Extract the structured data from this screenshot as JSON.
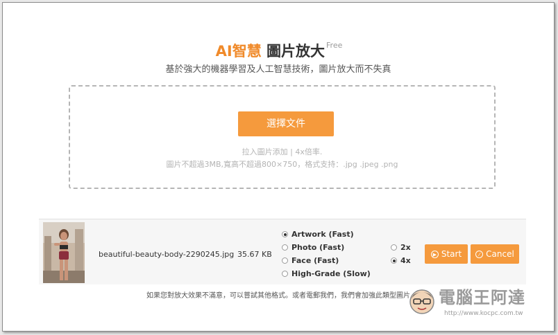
{
  "header": {
    "title_accent": "AI智慧",
    "title_main": "圖片放大",
    "free_label": "Free",
    "subtitle": "基於強大的機器學習及人工智慧技術，圖片放大而不失真"
  },
  "upload": {
    "button_label": "選擇文件",
    "hint_line1": "拉入圖片添加 | 4x倍率.",
    "hint_line2": "圖片不超過3MB,寬高不超過800×750，格式支持：.jpg .jpeg .png"
  },
  "file": {
    "name": "beautiful-beauty-body-2290245.jpg",
    "size": "35.67 KB",
    "modes": [
      {
        "label": "Artwork (Fast)",
        "selected": true
      },
      {
        "label": "Photo (Fast)",
        "selected": false
      },
      {
        "label": "Face (Fast)",
        "selected": false
      },
      {
        "label": "High-Grade (Slow)",
        "selected": false
      }
    ],
    "scales": [
      {
        "label": "2x",
        "selected": false
      },
      {
        "label": "4x",
        "selected": true
      }
    ],
    "start_label": "Start",
    "cancel_label": "Cancel"
  },
  "footer": {
    "note": "如果您對放大效果不滿意，可以嘗試其他格式。或者電郵我們，我們會加強此類型圖片"
  },
  "watermark": {
    "name": "電腦王阿達",
    "url": "http://www.kocpc.com.tw"
  },
  "colors": {
    "accent": "#f59a3d",
    "title_accent": "#f08a2a"
  }
}
